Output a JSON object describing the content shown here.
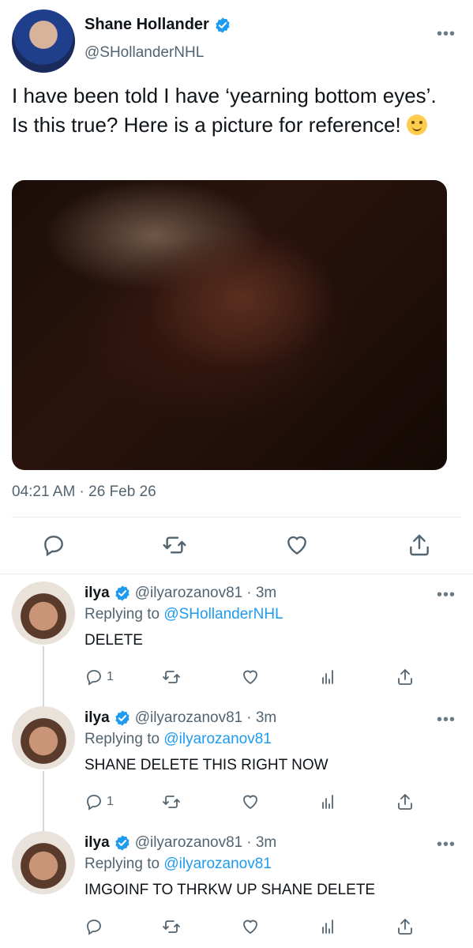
{
  "main_tweet": {
    "author_name": "Shane Hollander",
    "author_handle": "@SHollanderNHL",
    "more_label": "•••",
    "text": "I have been told I have ‘yearning bottom eyes’. Is this true? Here is a picture for reference! ",
    "timestamp": "04:21 AM · 26 Feb 26",
    "icons": [
      "reply-icon",
      "retweet-icon",
      "like-icon",
      "share-icon"
    ]
  },
  "replies": [
    {
      "author_name": "ilya",
      "author_handle": "@ilyarozanov81",
      "time": "· 3m",
      "replying_prefix": "Replying to ",
      "replying_to": "@SHollanderNHL",
      "text": "DELETE",
      "reply_count": "1",
      "more_label": "•••"
    },
    {
      "author_name": "ilya",
      "author_handle": "@ilyarozanov81",
      "time": "· 3m",
      "replying_prefix": "Replying to ",
      "replying_to": "@ilyarozanov81",
      "text": "SHANE DELETE THIS RIGHT NOW",
      "reply_count": "1",
      "more_label": "•••"
    },
    {
      "author_name": "ilya",
      "author_handle": "@ilyarozanov81",
      "time": "· 3m",
      "replying_prefix": "Replying to ",
      "replying_to": "@ilyarozanov81",
      "text": "IMGOINF TO THRKW UP SHANE DELETE",
      "reply_count": "",
      "more_label": "•••"
    }
  ],
  "colors": {
    "accent": "#1d9bf0",
    "secondary_text": "#536471",
    "primary_text": "#0f1419"
  }
}
